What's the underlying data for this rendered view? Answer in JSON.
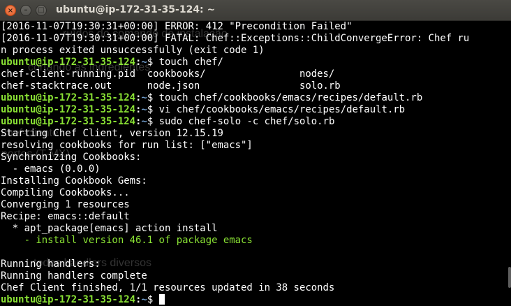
{
  "window": {
    "title": "ubuntu@ip-172-31-35-124: ~",
    "close_glyph": "×",
    "minimize_glyph": "–",
    "maximize_glyph": "□"
  },
  "colors": {
    "background": "#000000",
    "text": "#ffffff",
    "prompt_user": "#8ae234",
    "prompt_path": "#729fcf",
    "success_green": "#8ae234"
  },
  "prompt": {
    "user_host": "ubuntu@ip-172-31-35-124",
    "colon": ":",
    "path": "~",
    "dollar": "$ "
  },
  "lines": [
    "[2016-11-07T19:30:31+00:00] ERROR: 412 \"Precondition Failed\"",
    "[2016-11-07T19:30:31+00:00] FATAL: Chef::Exceptions::ChildConvergeError: Chef ru",
    "n process exited unsuccessfully (exit code 1)",
    "touch chef/",
    "chef-client-running.pid  cookbooks/                nodes/",
    "chef-stacktrace.out      node.json                 solo.rb",
    "touch chef/cookbooks/emacs/recipes/default.rb",
    "vi chef/cookbooks/emacs/recipes/default.rb",
    "sudo chef-solo -c chef/solo.rb",
    "Starting Chef Client, version 12.15.19",
    "resolving cookbooks for run list: [\"emacs\"]",
    "Synchronizing Cookbooks:",
    "  - emacs (0.0.0)",
    "Installing Cookbook Gems:",
    "Compiling Cookbooks...",
    "Converging 1 resources",
    "Recipe: emacs::default",
    "  * apt_package[emacs] action install",
    "    - install version 46.1 of package emacs",
    "",
    "Running handlers:",
    "Running handlers complete",
    "Chef Client finished, 1/1 resources updated in 38 seconds",
    ""
  ],
  "ghost_overlays": [
    "ruídos do comando de instalação",
    "cortando as ingredientes",
    "chef-cliente",
    "portos (T-MX)",
    "todos handlers diversos"
  ]
}
